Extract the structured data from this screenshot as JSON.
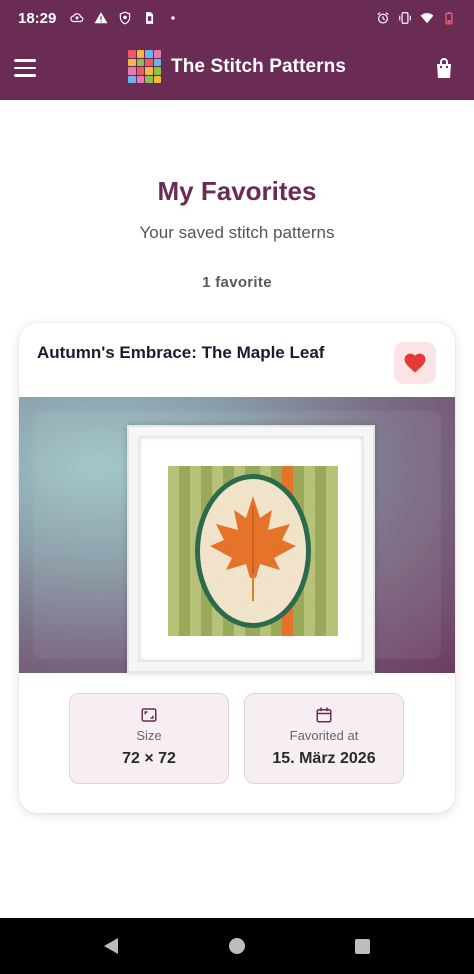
{
  "status_bar": {
    "time": "18:29",
    "left_icons": [
      "cloud-upload-icon",
      "warning-icon",
      "shield-icon",
      "sim-icon",
      "dot-icon"
    ],
    "right_icons": [
      "alarm-icon",
      "vibrate-icon",
      "wifi-icon",
      "battery-icon"
    ]
  },
  "app_bar": {
    "title": "The Stitch Patterns",
    "menu_icon": "menu-icon",
    "bag_icon": "shopping-bag-icon",
    "logo_colors": [
      "#e85d5d",
      "#f4b942",
      "#6bb5e8",
      "#e87ab0",
      "#f4b942",
      "#8bc34a",
      "#e85d5d",
      "#6bb5e8",
      "#e87ab0",
      "#e85d5d",
      "#f4b942",
      "#8bc34a",
      "#6bb5e8",
      "#e87ab0",
      "#8bc34a",
      "#f4b942"
    ]
  },
  "page": {
    "title": "My Favorites",
    "subtitle": "Your saved stitch patterns",
    "count": "1 favorite"
  },
  "favorites": [
    {
      "title": "Autumn's Embrace: The Maple Leaf",
      "favorite_icon": "heart-icon",
      "size_label": "Size",
      "size_value": "72 × 72",
      "favorited_label": "Favorited at",
      "favorited_value": "15. März 2026"
    }
  ],
  "colors": {
    "brand": "#6a2b55",
    "heart": "#e53935",
    "tile_bg": "#f6eef3"
  }
}
